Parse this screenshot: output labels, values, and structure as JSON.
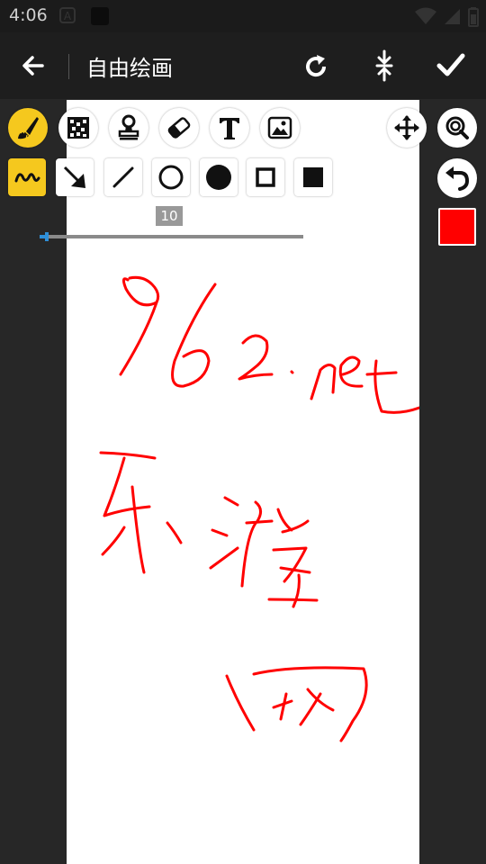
{
  "status_bar": {
    "time": "4:06",
    "icons": [
      "notification-a-icon",
      "notification-square-icon",
      "wifi-icon",
      "battery-icon"
    ]
  },
  "app_bar": {
    "title": "自由绘画",
    "icons": [
      "back-arrow-icon",
      "rotate-icon",
      "compress-icon",
      "check-icon"
    ]
  },
  "toolbar": {
    "tools": [
      "brush-icon",
      "mosaic-icon",
      "stamp-icon",
      "eraser-icon",
      "text-icon",
      "image-icon"
    ],
    "active_tool": "brush-icon",
    "right_tools": [
      "move-icon",
      "zoom-icon",
      "undo-icon"
    ],
    "shapes": [
      "freehand-wave-icon",
      "arrow-icon",
      "line-icon",
      "circle-outline-icon",
      "circle-filled-icon",
      "square-outline-icon",
      "square-filled-icon"
    ],
    "active_shape": "freehand-wave-icon"
  },
  "brush": {
    "size": "10",
    "size_fraction": 0.02,
    "color": "#ff0000"
  },
  "colors": {
    "accent": "#f5c81e",
    "canvas": "#ffffff",
    "background": "#272727",
    "stroke": "#ff0000"
  }
}
